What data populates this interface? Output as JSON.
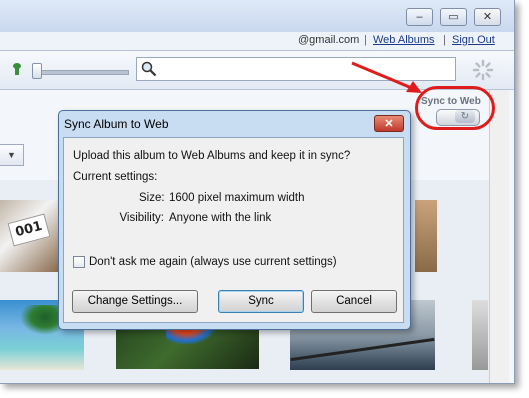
{
  "window": {
    "minimize_glyph": "–",
    "maximize_glyph": "▭",
    "close_glyph": "✕"
  },
  "linkbar": {
    "account": "@gmail.com",
    "web_albums": "Web Albums",
    "sign_out": "Sign Out",
    "separator": "|"
  },
  "toolbar": {
    "search_icon": "magnifier-icon",
    "location_icon": "map-pin-icon"
  },
  "sync_to_web": {
    "label": "Sync to Web",
    "toggle_glyph": "↻",
    "highlight_color": "#e01b1b"
  },
  "dropdown": {
    "glyph": "▼"
  },
  "gallery": {
    "tag_text": "001"
  },
  "dialog": {
    "title": "Sync Album to Web",
    "close_glyph": "✕",
    "message": "Upload this album to Web Albums and keep it in sync?",
    "current_settings_label": "Current settings:",
    "size_label": "Size:",
    "size_value": "1600 pixel maximum width",
    "visibility_label": "Visibility:",
    "visibility_value": "Anyone with the link",
    "checkbox_label": "Don't ask me again (always use current settings)",
    "checkbox_checked": false,
    "buttons": {
      "change_settings": "Change Settings...",
      "sync": "Sync",
      "cancel": "Cancel"
    }
  },
  "colors": {
    "dialog_frame": "#c8dcf2",
    "close_button": "#c0392b",
    "link": "#1b3a8a"
  }
}
